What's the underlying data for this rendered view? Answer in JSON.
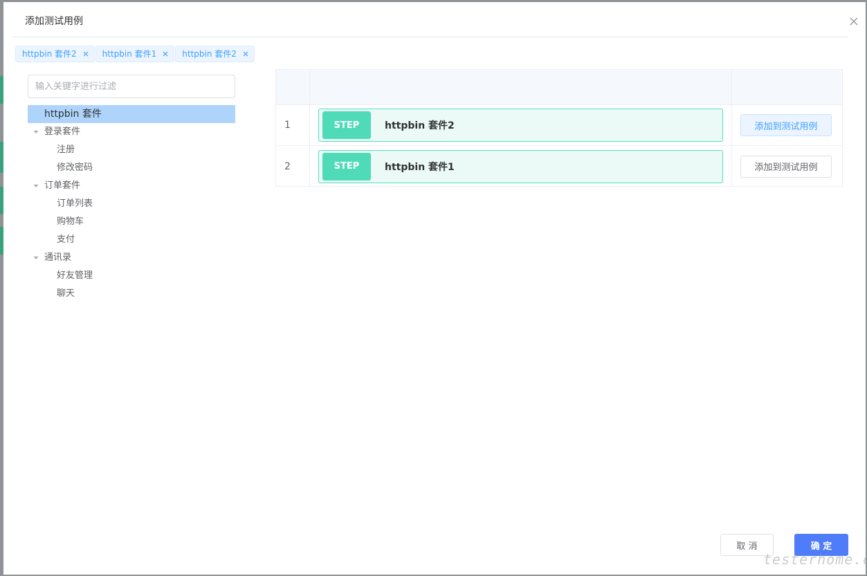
{
  "dialog": {
    "title": "添加测试用例"
  },
  "tags": [
    {
      "label": "httpbin 套件2"
    },
    {
      "label": "httpbin 套件1"
    },
    {
      "label": "httpbin 套件2"
    }
  ],
  "filter": {
    "placeholder": "输入关键字进行过滤"
  },
  "tree": {
    "root": "httpbin 套件",
    "groups": [
      {
        "label": "登录套件",
        "children": [
          "注册",
          "修改密码"
        ]
      },
      {
        "label": "订单套件",
        "children": [
          "订单列表",
          "购物车",
          "支付"
        ]
      },
      {
        "label": "通讯录",
        "children": [
          "好友管理",
          "聊天"
        ]
      }
    ]
  },
  "table": {
    "rows": [
      {
        "index": "1",
        "badge": "STEP",
        "name": "httpbin 套件2",
        "action": "添加到测试用例"
      },
      {
        "index": "2",
        "badge": "STEP",
        "name": "httpbin 套件1",
        "action": "添加到测试用例"
      }
    ]
  },
  "footer": {
    "cancel_label": "取 消",
    "ok_label": "确 定"
  },
  "watermark": "testerhome.com",
  "colors": {
    "primary": "#4f7cf8",
    "step_badge": "#4fdbb8",
    "selected_node": "#aed4fb",
    "tag_text": "#409eff"
  }
}
